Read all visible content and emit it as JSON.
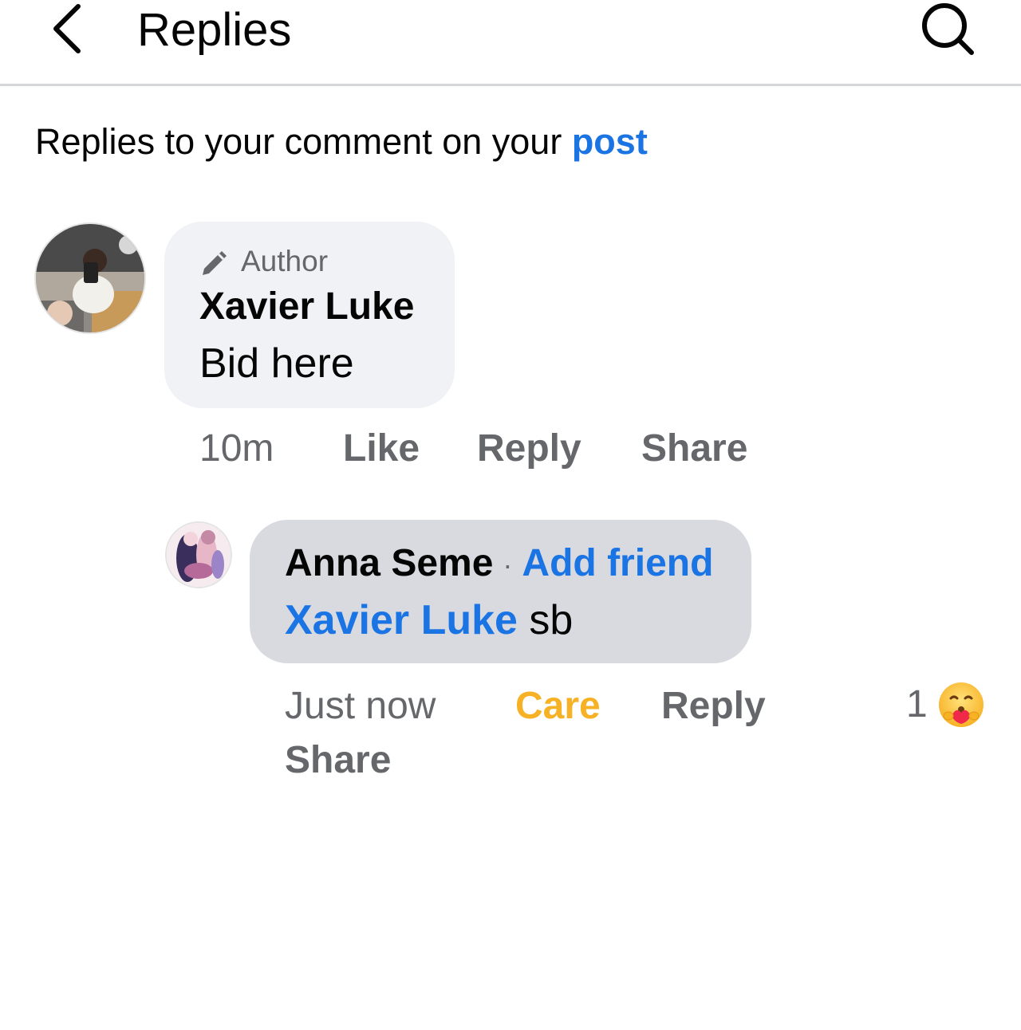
{
  "header": {
    "title": "Replies",
    "back_icon": "chevron-left-icon",
    "search_icon": "search-icon"
  },
  "subtitle": {
    "text": "Replies to your comment on your ",
    "link": "post"
  },
  "comment": {
    "badge": "Author",
    "badge_icon": "pencil-icon",
    "author": "Xavier Luke",
    "text": "Bid here",
    "time": "10m",
    "like_label": "Like",
    "reply_label": "Reply",
    "share_label": "Share"
  },
  "reply": {
    "author": "Anna Seme",
    "separator": "·",
    "add_friend_label": "Add friend",
    "mention": "Xavier Luke",
    "text": " sb",
    "time": "Just now",
    "care_label": "Care",
    "reply_label": "Reply",
    "share_label": "Share",
    "reaction_count": "1",
    "reaction_icon": "care-emoji-icon"
  },
  "colors": {
    "accent_blue": "#1b74e4",
    "care_yellow": "#f7b125",
    "secondary_text": "#65676b",
    "bubble_light": "#f0f2f5",
    "bubble_dark": "#d8dadf"
  }
}
